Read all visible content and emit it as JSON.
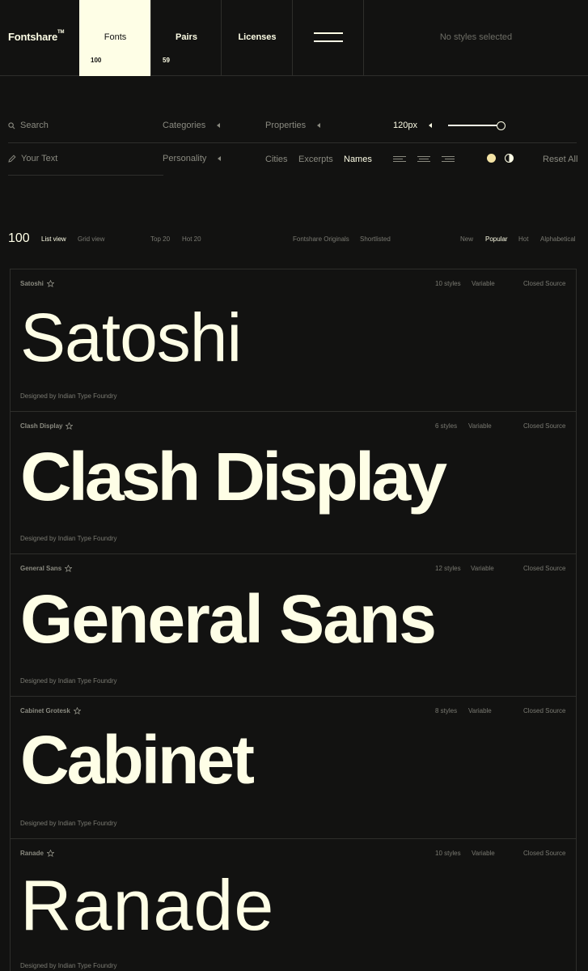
{
  "nav": {
    "logo": "Fontshare",
    "logo_tm": "TM",
    "fonts_label": "Fonts",
    "fonts_count": "100",
    "pairs_label": "Pairs",
    "pairs_count": "59",
    "licenses_label": "Licenses",
    "status": "No styles selected"
  },
  "filters": {
    "search_placeholder": "Search",
    "text_placeholder": "Your Text",
    "categories": "Categories",
    "properties": "Properties",
    "personality": "Personality",
    "size": "120px",
    "size_level": 1.0,
    "text_tabs": [
      "Cities",
      "Excerpts",
      "Names"
    ],
    "active_text_tab": "Names",
    "reset": "Reset All"
  },
  "list_header": {
    "total": "100",
    "views": [
      "List view",
      "Grid view"
    ],
    "tops": [
      "Top 20",
      "Hot 20"
    ],
    "collections": [
      "Fontshare Originals",
      "Shortlisted"
    ],
    "sorts": [
      "New",
      "Popular",
      "Hot",
      "Alphabetical"
    ]
  },
  "fonts": [
    {
      "name": "Satoshi",
      "sample": "Satoshi",
      "styles": "10 styles",
      "variable": "Variable",
      "license": "Closed Source",
      "designer": "Designed by Indian Type Foundry"
    },
    {
      "name": "Clash Display",
      "sample": "Clash Display",
      "styles": "6 styles",
      "variable": "Variable",
      "license": "Closed Source",
      "designer": "Designed by Indian Type Foundry"
    },
    {
      "name": "General Sans",
      "sample": "General Sans",
      "styles": "12 styles",
      "variable": "Variable",
      "license": "Closed Source",
      "designer": "Designed by Indian Type Foundry"
    },
    {
      "name": "Cabinet Grotesk",
      "sample": "Cabinet",
      "styles": "8 styles",
      "variable": "Variable",
      "license": "Closed Source",
      "designer": "Designed by Indian Type Foundry"
    },
    {
      "name": "Ranade",
      "sample": "Ranade",
      "styles": "10 styles",
      "variable": "Variable",
      "license": "Closed Source",
      "designer": "Designed by Indian Type Foundry"
    }
  ],
  "colors": {
    "background": "#121211",
    "foreground": "#fefee6",
    "accent_dot": "#f3e3a5",
    "muted": "#8a8a80"
  }
}
